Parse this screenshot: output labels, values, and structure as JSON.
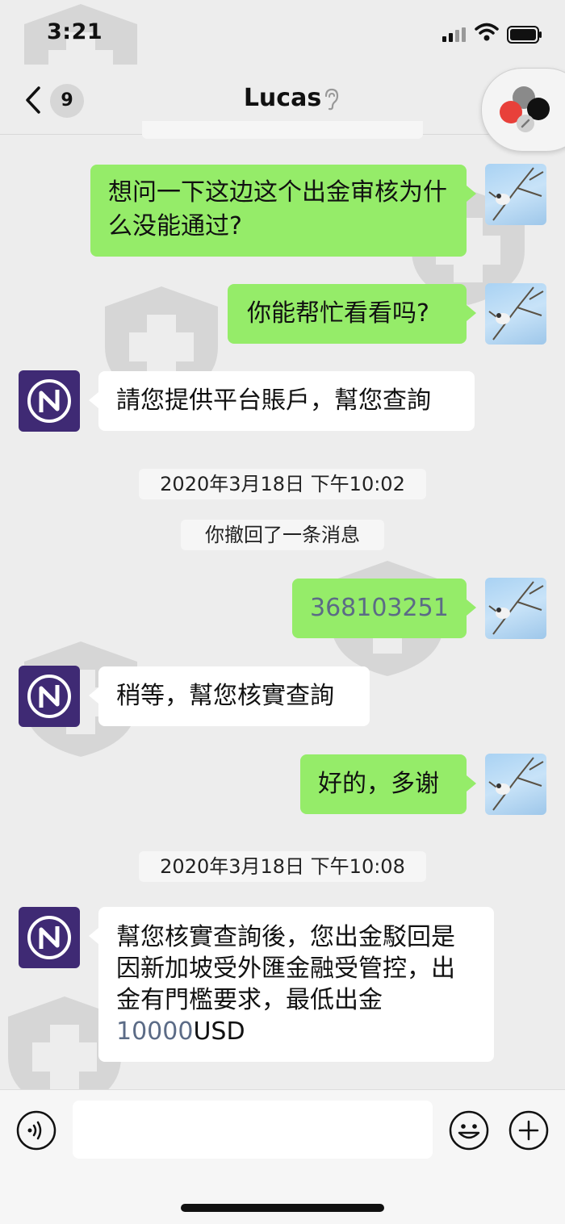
{
  "status_bar": {
    "time": "3:21"
  },
  "header": {
    "back_count": "9",
    "title": "Lucas"
  },
  "messages": [
    {
      "side": "out",
      "text": "想问一下这边这个出金审核为什么没能通过?"
    },
    {
      "side": "out",
      "text": "你能帮忙看看吗?"
    },
    {
      "side": "in",
      "text": "請您提供平台賬戶，幫您查詢"
    },
    {
      "type": "timestamp",
      "text": "2020年3月18日 下午10:02"
    },
    {
      "type": "system",
      "text": "你撤回了一条消息"
    },
    {
      "side": "out",
      "text": "368103251"
    },
    {
      "side": "in",
      "text": "稍等，幫您核實查詢"
    },
    {
      "side": "out",
      "text": "好的，多谢"
    },
    {
      "type": "timestamp",
      "text": "2020年3月18日 下午10:08"
    },
    {
      "side": "in",
      "text_parts": [
        "幫您核實查詢後，您出金駁回是因新加坡受外匯金融受管控，出金有門檻要求，最低出金",
        "10000",
        "USD"
      ]
    }
  ],
  "input": {
    "placeholder": ""
  },
  "icons": {
    "back": "chevron-left-icon",
    "ear": "ear-icon",
    "voice": "voice-icon",
    "emoji": "emoji-icon",
    "plus": "plus-icon",
    "signal": "signal-icon",
    "wifi": "wifi-icon",
    "battery": "battery-icon"
  },
  "colors": {
    "outgoing_bubble": "#95ec69",
    "incoming_bubble": "#ffffff",
    "background": "#ededed",
    "bot_avatar": "#3f2a74"
  }
}
